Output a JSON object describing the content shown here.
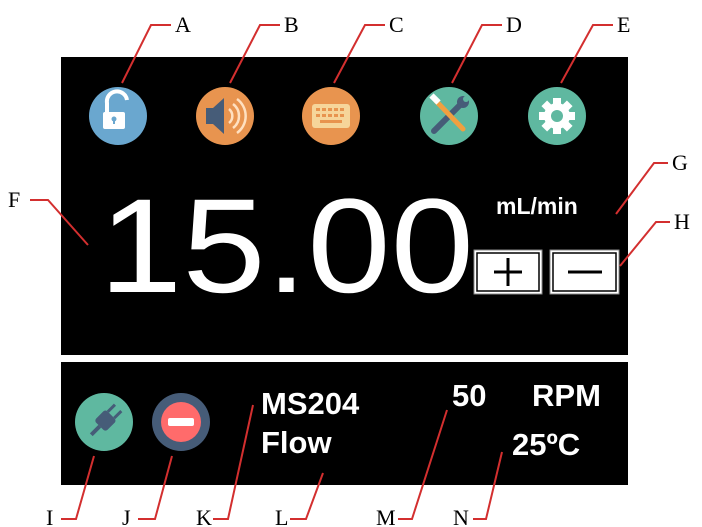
{
  "callouts": {
    "a": "A",
    "b": "B",
    "c": "C",
    "d": "D",
    "e": "E",
    "f": "F",
    "g": "G",
    "h": "H",
    "i": "I",
    "j": "J",
    "k": "K",
    "l": "L",
    "m": "M",
    "n": "N"
  },
  "display": {
    "flow_value": "15.00",
    "unit": "mL/min",
    "plus_symbol": "+",
    "minus_symbol": "−"
  },
  "status": {
    "model": "MS204",
    "mode": "Flow",
    "speed_value": "50",
    "speed_unit": "RPM",
    "temperature": "25ºC"
  },
  "icons": {
    "lock": "unlock-icon",
    "sound": "speaker-icon",
    "keyboard": "keyboard-icon",
    "tools": "tools-icon",
    "settings": "gear-icon",
    "power": "plug-icon",
    "stop": "stop-icon"
  },
  "colors": {
    "panel": "#000000",
    "lock": "#6aa7cf",
    "sound": "#e8944f",
    "keyboard": "#e8944f",
    "tools": "#5fb8a0",
    "settings": "#5fb8a0",
    "power": "#5fb8a0",
    "stop": "#465c78",
    "leader": "#d32f2f"
  }
}
